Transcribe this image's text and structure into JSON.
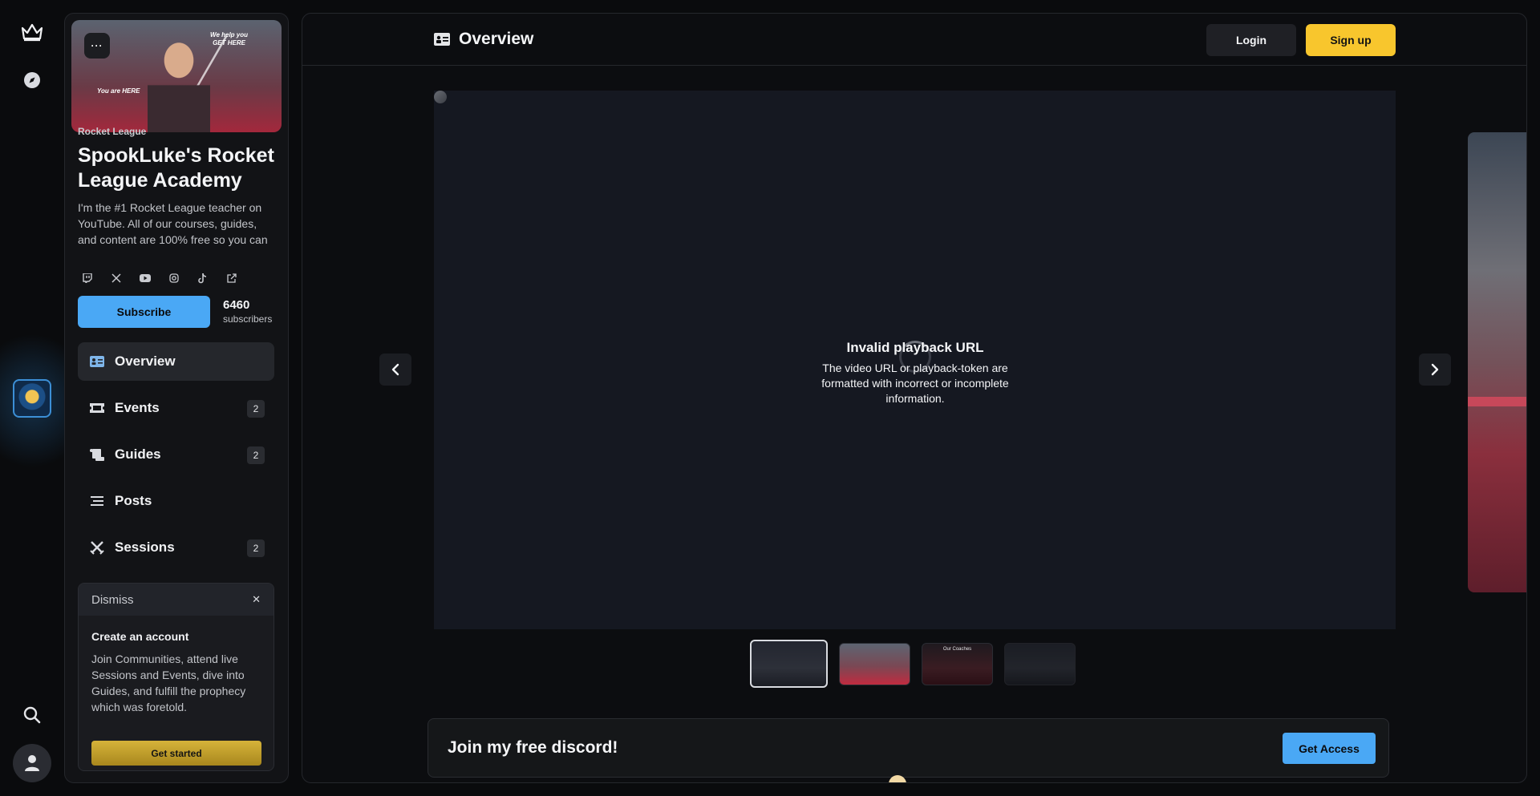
{
  "rail": {
    "items": [
      {
        "icon": "crown-icon"
      },
      {
        "icon": "compass-icon"
      },
      {
        "icon": "community-avatar"
      },
      {
        "icon": "search-icon"
      },
      {
        "icon": "user-icon"
      }
    ]
  },
  "sidebar": {
    "banner": {
      "menu_label": "···",
      "tagline": "We help you\nGET HERE",
      "you_are_here": "You are HERE"
    },
    "category": "Rocket League",
    "title": "SpookLuke's Rocket League Academy",
    "description": "I'm the #1 Rocket League teacher on YouTube. All of our courses, guides, and content are 100% free so you can",
    "socials": [
      "twitch-icon",
      "x-icon",
      "youtube-icon",
      "instagram-icon",
      "tiktok-icon",
      "external-link-icon"
    ],
    "subscribe_label": "Subscribe",
    "subscriber_count": "6460",
    "subscriber_label": "subscribers",
    "nav": [
      {
        "label": "Overview",
        "icon": "id-card-icon",
        "badge": "",
        "active": true
      },
      {
        "label": "Events",
        "icon": "ticket-icon",
        "badge": "2",
        "active": false
      },
      {
        "label": "Guides",
        "icon": "scroll-icon",
        "badge": "2",
        "active": false
      },
      {
        "label": "Posts",
        "icon": "list-icon",
        "badge": "",
        "active": false
      },
      {
        "label": "Sessions",
        "icon": "swords-icon",
        "badge": "2",
        "active": false
      }
    ],
    "dismiss_label": "Dismiss",
    "dismiss_close": "✕",
    "create_account": {
      "title": "Create an account",
      "description": "Join Communities, attend live Sessions and Events, dive into Guides, and fulfill the prophecy which was foretold.",
      "button": "Get started"
    }
  },
  "header": {
    "title": "Overview",
    "login_label": "Login",
    "signup_label": "Sign up"
  },
  "player": {
    "error_title": "Invalid playback URL",
    "error_description": "The video URL or playback-token are formatted with incorrect or incomplete information."
  },
  "thumbnails": [
    {
      "active": true,
      "label": ""
    },
    {
      "active": false,
      "label": ""
    },
    {
      "active": false,
      "label": "Our Coaches"
    },
    {
      "active": false,
      "label": ""
    }
  ],
  "discord": {
    "title": "Join my free discord!",
    "button": "Get Access"
  },
  "colors": {
    "accent_blue": "#4aa8f5",
    "accent_yellow": "#f8c62d",
    "background": "#0a0b0d",
    "panel": "#121316"
  }
}
